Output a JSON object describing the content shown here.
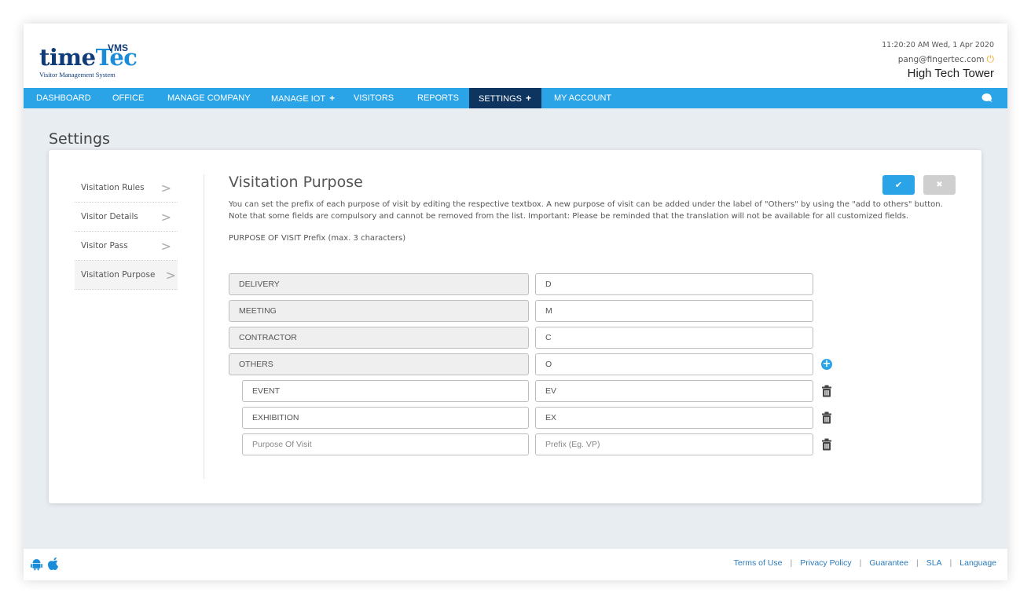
{
  "brand": {
    "name_part1": "time",
    "name_part2": "Tec",
    "suffix": "VMS",
    "tagline": "Visitor Management System"
  },
  "header": {
    "datetime": "11:20:20 AM  Wed, 1 Apr 2020",
    "user_email": "pang@fingertec.com",
    "site_name": "High Tech Tower",
    "power_icon": "power-icon",
    "accent_color": "#f5a623"
  },
  "nav": {
    "background": "#2aa4e6",
    "active_background": "#0e3560",
    "items": [
      {
        "label": "DASHBOARD",
        "has_submenu": false,
        "active": false
      },
      {
        "label": "OFFICE",
        "has_submenu": false,
        "active": false
      },
      {
        "label": "MANAGE COMPANY",
        "has_submenu": false,
        "active": false
      },
      {
        "label": "MANAGE IOT",
        "has_submenu": true,
        "active": false
      },
      {
        "label": "VISITORS",
        "has_submenu": false,
        "active": false
      },
      {
        "label": "REPORTS",
        "has_submenu": false,
        "active": false
      },
      {
        "label": "SETTINGS",
        "has_submenu": true,
        "active": true
      },
      {
        "label": "MY ACCOUNT",
        "has_submenu": false,
        "active": false
      }
    ],
    "plus_glyph": "+",
    "chat_icon": "chat-bubble-icon"
  },
  "page": {
    "title": "Settings"
  },
  "sidebar": {
    "items": [
      {
        "label": "Visitation Rules",
        "active": false
      },
      {
        "label": "Visitor Details",
        "active": false
      },
      {
        "label": "Visitor Pass",
        "active": false
      },
      {
        "label": "Visitation Purpose",
        "active": true
      }
    ],
    "chevron_glyph": ">"
  },
  "main": {
    "title": "Visitation Purpose",
    "description": "You can set the prefix of each purpose of visit by editing the respective textbox. A new purpose of visit can be added under the label of \"Others\" by using the \"add to others\" button. Note that some fields are compulsory and cannot be removed from the list. Important: Please be reminded that the translation will not be available for all customized fields.",
    "prefix_label": "PURPOSE OF VISIT Prefix (max. 3 characters)",
    "save_icon": "check-icon",
    "cancel_icon": "close-icon",
    "save_glyph": "✔",
    "cancel_glyph": "✖"
  },
  "purposes": {
    "fixed": [
      {
        "name": "DELIVERY",
        "prefix": "D"
      },
      {
        "name": "MEETING",
        "prefix": "M"
      },
      {
        "name": "CONTRACTOR",
        "prefix": "C"
      },
      {
        "name": "OTHERS",
        "prefix": "O"
      }
    ],
    "others": [
      {
        "name": "EVENT",
        "prefix": "EV"
      },
      {
        "name": "EXHIBITION",
        "prefix": "EX"
      }
    ],
    "new_entry": {
      "name_placeholder": "Purpose Of Visit",
      "prefix_placeholder": "Prefix (Eg. VP)"
    },
    "add_glyph": "+"
  },
  "footer": {
    "links": [
      "Terms of Use",
      "Privacy Policy",
      "Guarantee",
      "SLA",
      "Language"
    ],
    "separator": "|",
    "icons": [
      "android-icon",
      "apple-icon"
    ]
  }
}
